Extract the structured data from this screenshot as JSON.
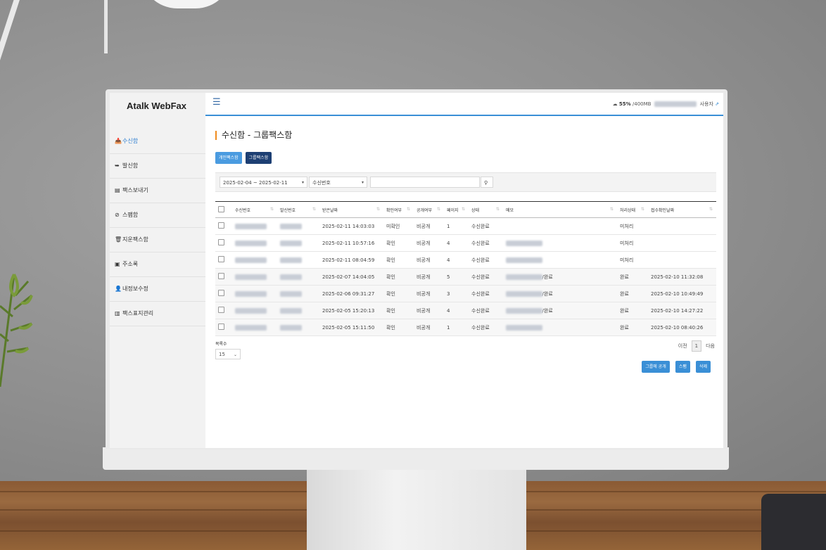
{
  "app": {
    "brand": "Atalk WebFax"
  },
  "sidebar": {
    "items": [
      {
        "icon": "inbox-icon",
        "glyph": "📥",
        "label": "수신함",
        "active": true
      },
      {
        "icon": "send-icon",
        "glyph": "➥",
        "label": "발신함"
      },
      {
        "icon": "fax-icon",
        "glyph": "▤",
        "label": "팩스보내기"
      },
      {
        "icon": "spam-icon",
        "glyph": "⊘",
        "label": "스팸함"
      },
      {
        "icon": "trash-icon",
        "glyph": "🗑",
        "label": "지운팩스함"
      },
      {
        "icon": "address-book-icon",
        "glyph": "▣",
        "label": "주소록"
      },
      {
        "icon": "user-edit-icon",
        "glyph": "👤",
        "label": "내정보수정"
      },
      {
        "icon": "cover-page-icon",
        "glyph": "▥",
        "label": "팩스표지관리"
      }
    ]
  },
  "topbar": {
    "menu_icon": "☰",
    "storage_percent": "55%",
    "storage_total": "/400MB",
    "user_label": "사용자",
    "logout_icon": "⇗"
  },
  "page": {
    "title": "수신함 - 그룹팩스함",
    "tabs": [
      {
        "label": "개인팩스함",
        "style": "light"
      },
      {
        "label": "그룹팩스함",
        "style": "dark"
      }
    ]
  },
  "filter": {
    "date_range": "2025-02-04 ~ 2025-02-11",
    "search_field": "수신번호",
    "search_value": "",
    "search_icon": "🔍"
  },
  "table": {
    "columns": [
      "수신번호",
      "발신번호",
      "받은날짜",
      "확인여부",
      "공개여부",
      "페이지",
      "상태",
      "메모",
      "처리상태",
      "접수확인날짜"
    ],
    "rows": [
      {
        "received": "2025-02-11 14:03:03",
        "checked": "미확인",
        "public": "비공개",
        "pages": "1",
        "status": "수신완료",
        "memo_suffix": "",
        "proc": "미처리",
        "ack": ""
      },
      {
        "received": "2025-02-11 10:57:16",
        "checked": "확인",
        "public": "비공개",
        "pages": "4",
        "status": "수신완료",
        "memo_suffix": "",
        "proc": "미처리",
        "ack": ""
      },
      {
        "received": "2025-02-11 08:04:59",
        "checked": "확인",
        "public": "비공개",
        "pages": "4",
        "status": "수신완료",
        "memo_suffix": "",
        "proc": "미처리",
        "ack": ""
      },
      {
        "received": "2025-02-07 14:04:05",
        "checked": "확인",
        "public": "비공개",
        "pages": "5",
        "status": "수신완료",
        "memo_suffix": "/완료",
        "proc": "완료",
        "ack": "2025-02-10 11:32:08"
      },
      {
        "received": "2025-02-06 09:31:27",
        "checked": "확인",
        "public": "비공개",
        "pages": "3",
        "status": "수신완료",
        "memo_suffix": "/완료",
        "proc": "완료",
        "ack": "2025-02-10 10:49:49"
      },
      {
        "received": "2025-02-05 15:20:13",
        "checked": "확인",
        "public": "비공개",
        "pages": "4",
        "status": "수신완료",
        "memo_suffix": "/완료",
        "proc": "완료",
        "ack": "2025-02-10 14:27:22"
      },
      {
        "received": "2025-02-05 15:11:50",
        "checked": "확인",
        "public": "비공개",
        "pages": "1",
        "status": "수신완료",
        "memo_suffix": "",
        "proc": "완료",
        "ack": "2025-02-10 08:40:26"
      }
    ]
  },
  "pagination": {
    "per_page_label": "목록수",
    "per_page": "15",
    "prev": "이전",
    "current": "1",
    "next": "다음"
  },
  "actions": [
    "그룹에 공개",
    "스팸",
    "삭제"
  ],
  "colors": {
    "accent": "#3a8fd6",
    "dark_tab": "#1d3f73",
    "title_bar": "#f08c1e"
  }
}
